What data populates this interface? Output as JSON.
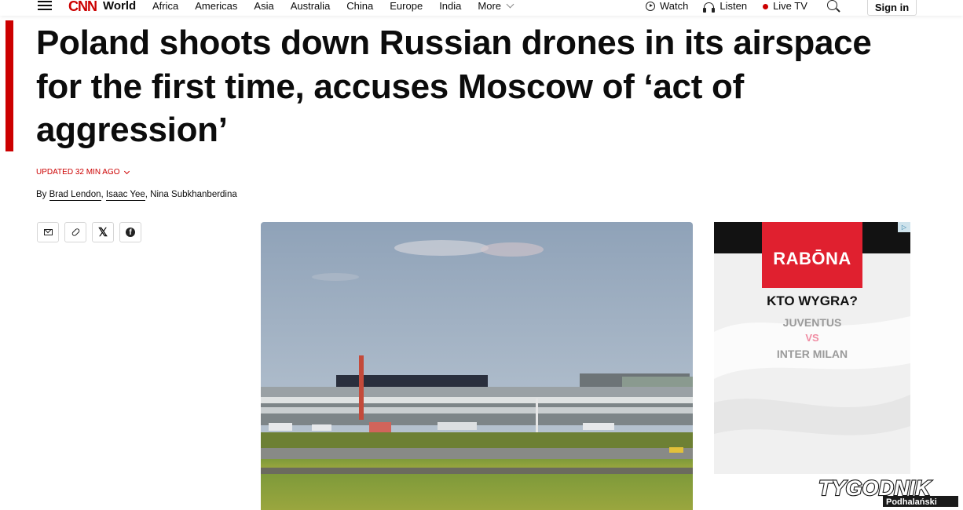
{
  "nav": {
    "logo": "CNN",
    "section": "World",
    "links": [
      "Africa",
      "Americas",
      "Asia",
      "Australia",
      "China",
      "Europe",
      "India"
    ],
    "more": "More",
    "watch": "Watch",
    "listen": "Listen",
    "live_tv": "Live TV",
    "sign_in": "Sign in"
  },
  "article": {
    "headline": "Poland shoots down Russian drones in its airspace for the first time, accuses Moscow of ‘act of aggression’",
    "timestamp": "UPDATED 32 MIN AGO",
    "byline_prefix": "By",
    "authors": [
      "Brad Lendon",
      "Isaac Yee",
      "Nina Subkhanberdina"
    ]
  },
  "share": [
    "email-icon",
    "link-icon",
    "x-icon",
    "facebook-icon"
  ],
  "ad": {
    "brand": "RABŌNA",
    "question": "KTO WYGRA?",
    "team1": "JUVENTUS",
    "vs": "VS",
    "team2": "INTER MILAN",
    "choices": "▷"
  },
  "watermark": {
    "title": "TYGODNIK",
    "subtitle": "Podhalański"
  },
  "colors": {
    "accent": "#cc0000",
    "ad_red": "#e0202f",
    "ad_vs": "#f08ca2"
  }
}
